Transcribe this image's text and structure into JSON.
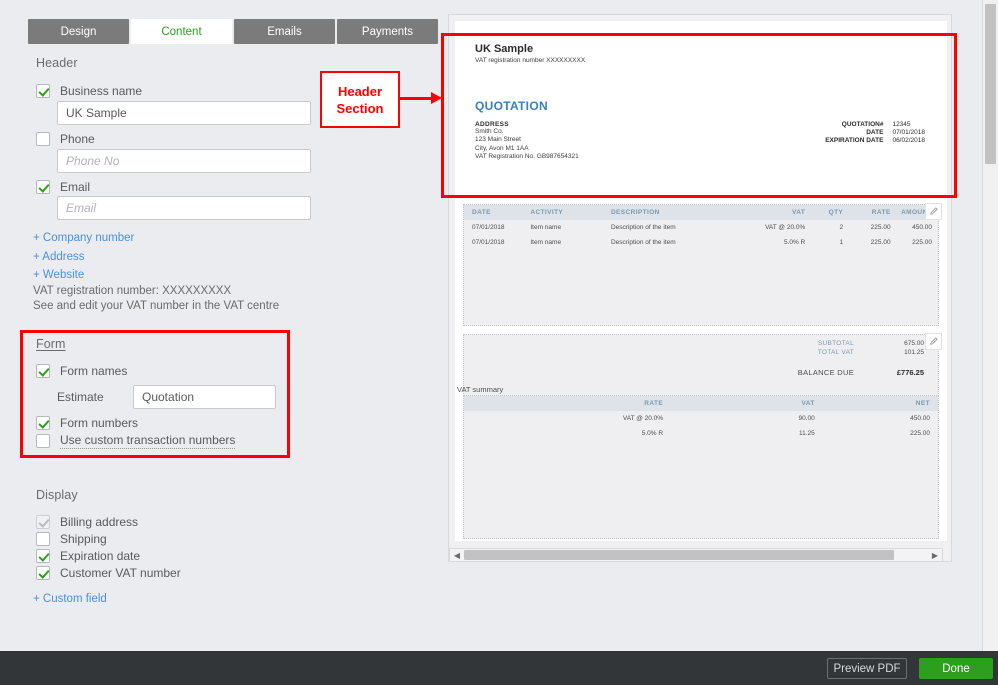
{
  "tabs": [
    {
      "label": "Design",
      "active": false
    },
    {
      "label": "Content",
      "active": true
    },
    {
      "label": "Emails",
      "active": false
    },
    {
      "label": "Payments",
      "active": false
    }
  ],
  "sections": {
    "header_title": "Header",
    "form_title": "Form",
    "display_title": "Display"
  },
  "header_fields": {
    "business_name_label": "Business name",
    "business_name_value": "UK Sample",
    "phone_label": "Phone",
    "phone_placeholder": "Phone No",
    "email_label": "Email",
    "email_placeholder": "Email",
    "links": [
      "+ Company number",
      "+ Address",
      "+ Website"
    ],
    "vat_note_line1": "VAT registration number: XXXXXXXXX",
    "vat_note_line2": "See and edit your VAT number in the VAT centre"
  },
  "form_fields": {
    "form_names_label": "Form names",
    "estimate_label": "Estimate",
    "estimate_value": "Quotation",
    "form_numbers_label": "Form numbers",
    "custom_numbers_label": "Use custom transaction numbers"
  },
  "display_fields": {
    "items": [
      {
        "label": "Billing address",
        "checked": true,
        "disabled": true
      },
      {
        "label": "Shipping",
        "checked": false,
        "disabled": false
      },
      {
        "label": "Expiration date",
        "checked": true,
        "disabled": false
      },
      {
        "label": "Customer VAT number",
        "checked": true,
        "disabled": false
      }
    ],
    "custom_field_link": "+ Custom field"
  },
  "annotation": {
    "callout_line1": "Header",
    "callout_line2": "Section",
    "color": "#ff0000"
  },
  "preview": {
    "company_name": "UK Sample",
    "company_vat_line": "VAT registration number XXXXXXXXX",
    "doc_type": "QUOTATION",
    "address_label": "ADDRESS",
    "address_lines": [
      "Smith Co.",
      "123 Main Street",
      "City, Avon M1 1AA",
      "VAT Registration No. GB987654321"
    ],
    "meta": [
      {
        "label": "QUOTATION#",
        "value": "12345"
      },
      {
        "label": "DATE",
        "value": "07/01/2018"
      },
      {
        "label": "EXPIRATION DATE",
        "value": "06/02/2018"
      }
    ],
    "items_table": {
      "columns": [
        "DATE",
        "ACTIVITY",
        "DESCRIPTION",
        "VAT",
        "QTY",
        "RATE",
        "AMOUNT"
      ],
      "rows": [
        {
          "date": "07/01/2018",
          "activity": "Item name",
          "description": "Description of the item",
          "vat": "VAT @ 20.0%",
          "qty": "2",
          "rate": "225.00",
          "amount": "450.00"
        },
        {
          "date": "07/01/2018",
          "activity": "Item name",
          "description": "Description of the item",
          "vat": "5.0% R",
          "qty": "1",
          "rate": "225.00",
          "amount": "225.00"
        }
      ]
    },
    "totals": {
      "subtotal_label": "SUBTOTAL",
      "subtotal_value": "675.00",
      "total_vat_label": "TOTAL VAT",
      "total_vat_value": "101.25",
      "balance_label": "BALANCE DUE",
      "balance_value": "£776.25"
    },
    "vat_summary": {
      "title": "VAT summary",
      "columns": [
        "RATE",
        "VAT",
        "NET"
      ],
      "rows": [
        {
          "rate": "VAT @ 20.0%",
          "vat": "90.00",
          "net": "450.00"
        },
        {
          "rate": "5.0% R",
          "vat": "11.25",
          "net": "225.00"
        }
      ]
    }
  },
  "footer": {
    "preview_pdf_label": "Preview PDF",
    "done_label": "Done"
  }
}
